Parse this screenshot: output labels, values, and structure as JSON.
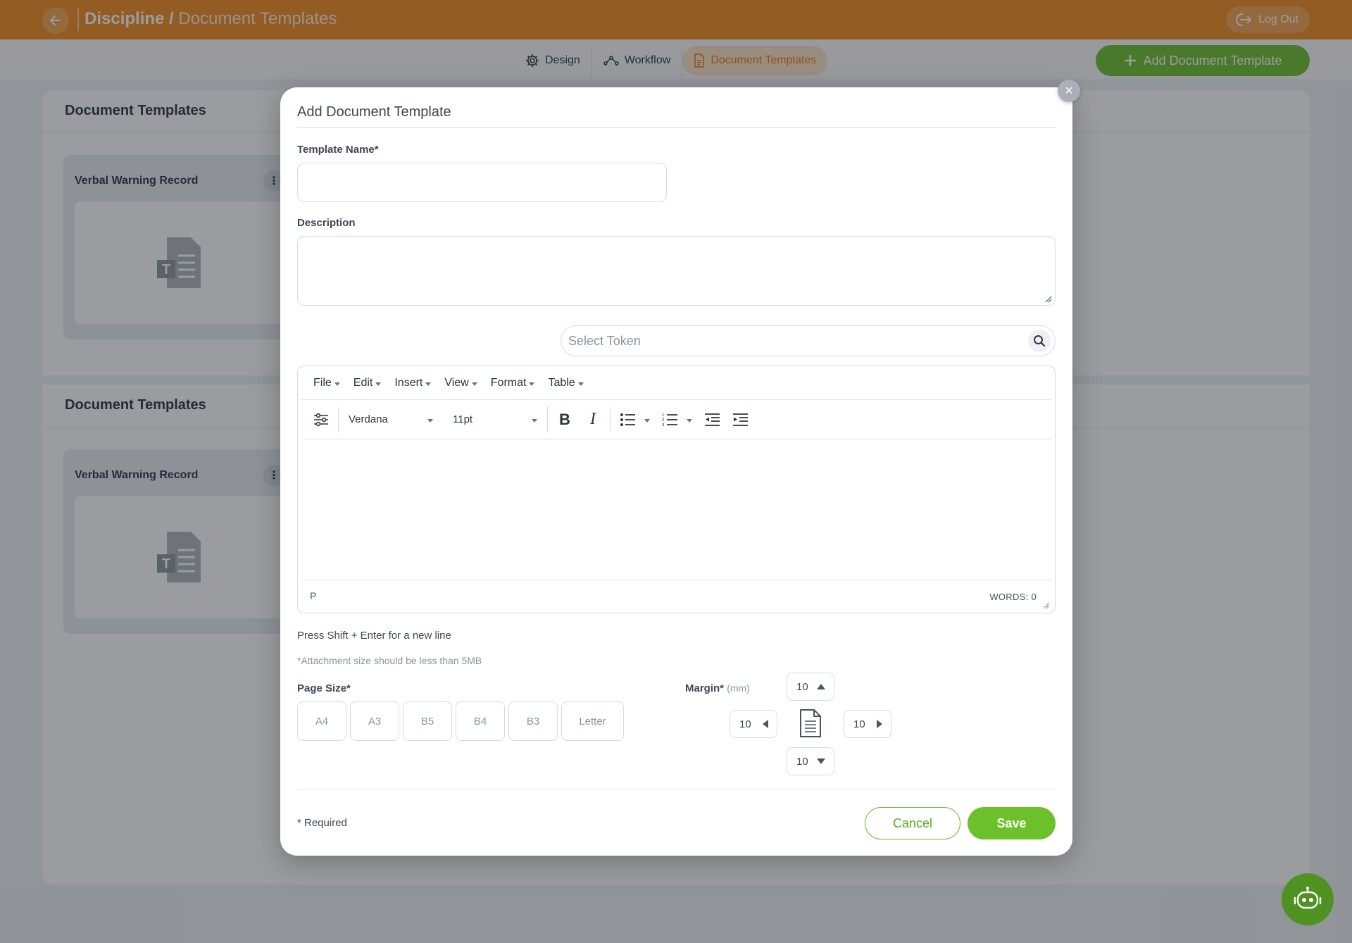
{
  "header": {
    "title_primary": "Discipline /",
    "title_secondary": "Document Templates",
    "logout_label": "Log Out"
  },
  "subnav": {
    "tabs": [
      {
        "label": "Design",
        "icon": "gear-icon"
      },
      {
        "label": "Workflow",
        "icon": "workflow-icon"
      },
      {
        "label": "Document Templates",
        "icon": "document-icon",
        "active": true
      }
    ],
    "add_button_label": "Add Document Template"
  },
  "sections": [
    {
      "title": "Document Templates",
      "cards": [
        {
          "title": "Verbal Warning Record"
        }
      ]
    },
    {
      "title": "Document Templates",
      "cards": [
        {
          "title": "Verbal Warning Record"
        }
      ]
    }
  ],
  "card_menu_glyph": "⋮",
  "modal": {
    "title": "Add Document Template",
    "close_glyph": "×",
    "template_name_label": "Template Name*",
    "template_name_value": "",
    "description_label": "Description",
    "description_value": "",
    "token_placeholder": "Select Token",
    "editor": {
      "menus": [
        "File",
        "Edit",
        "Insert",
        "View",
        "Format",
        "Table"
      ],
      "font_family": "Verdana",
      "font_size": "11pt",
      "bold_glyph": "B",
      "italic_glyph": "I",
      "path": "P",
      "word_count": "WORDS: 0"
    },
    "hint_newline": "Press Shift + Enter for a new line",
    "hint_attachment": "*Attachment size should be less than 5MB",
    "page_size_label": "Page Size*",
    "page_sizes": [
      "A4",
      "A3",
      "B5",
      "B4",
      "B3",
      "Letter"
    ],
    "margin_label": "Margin*",
    "margin_unit": "(mm)",
    "margins": {
      "top": "10",
      "left": "10",
      "right": "10",
      "bottom": "10"
    },
    "required_note": "* Required",
    "cancel_label": "Cancel",
    "save_label": "Save"
  },
  "colors": {
    "brand_orange": "#f28a1c",
    "accent_green": "#6cc02a",
    "active_tab_bg": "#fde3c5"
  }
}
